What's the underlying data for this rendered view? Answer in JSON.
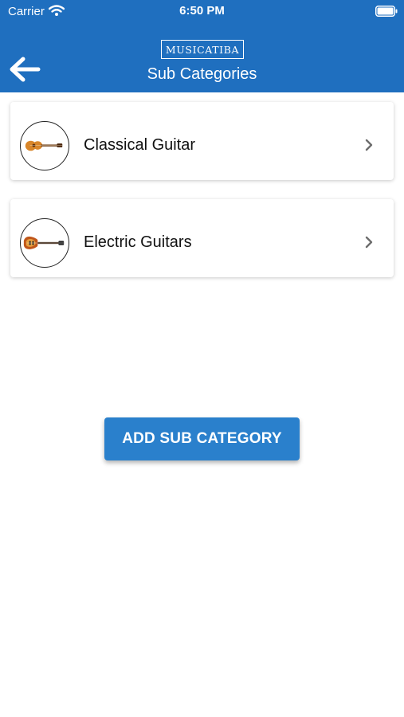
{
  "status_bar": {
    "carrier": "Carrier",
    "time": "6:50 PM"
  },
  "header": {
    "logo_text": "MUSICATIBA",
    "title": "Sub Categories",
    "back_icon": "arrow-left-icon",
    "color": "#1f6fbf"
  },
  "subcategories": [
    {
      "label": "Classical Guitar",
      "icon": "classical-guitar-image"
    },
    {
      "label": "Electric Guitars",
      "icon": "electric-guitar-image"
    }
  ],
  "actions": {
    "add_label": "ADD SUB CATEGORY",
    "color": "#2a80cc"
  }
}
